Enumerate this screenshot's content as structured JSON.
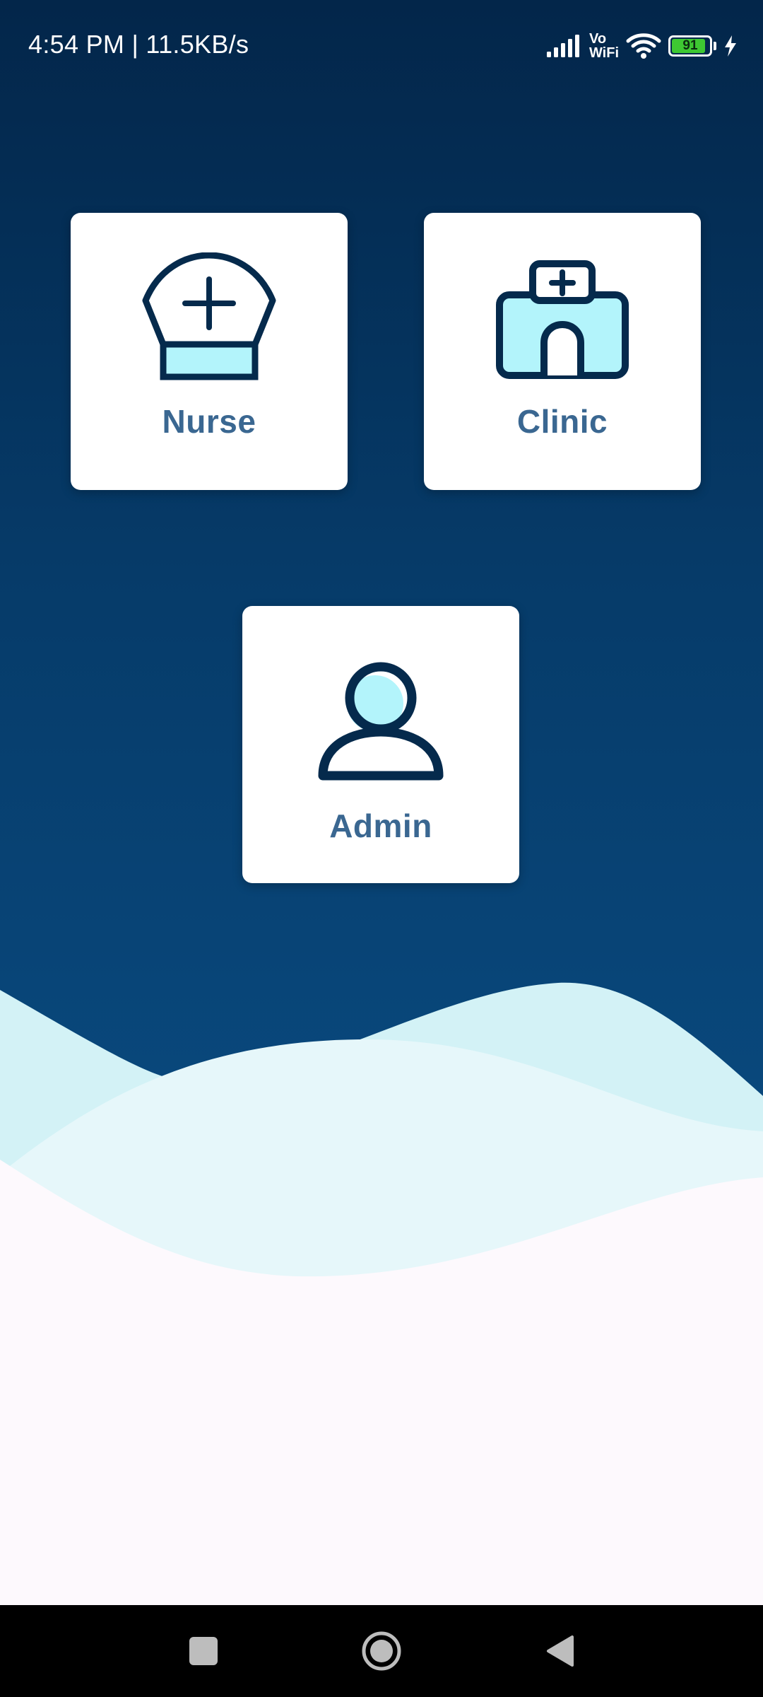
{
  "status_bar": {
    "time": "4:54 PM | 11.5KB/s",
    "vo_label": "Vo",
    "wifi_label": "WiFi",
    "battery_level": "91",
    "battery_fraction": 0.91,
    "icons": [
      "signal-icon",
      "vowifi-icon",
      "wifi-icon",
      "battery-icon",
      "charging-icon"
    ]
  },
  "roles": {
    "nurse": {
      "label": "Nurse",
      "icon": "nurse-cap-icon"
    },
    "clinic": {
      "label": "Clinic",
      "icon": "clinic-building-icon"
    },
    "admin": {
      "label": "Admin",
      "icon": "user-icon"
    }
  },
  "nav": {
    "icons": [
      "recents-square-icon",
      "home-circle-icon",
      "back-triangle-icon"
    ]
  },
  "colors": {
    "background_top": "#03264a",
    "background_bottom": "#0a4c82",
    "icon_stroke": "#052a4c",
    "icon_fill": "#b3f4fb",
    "label": "#3a6791",
    "wave_light": "#d6f4f8",
    "page_bottom": "#fdf9fd"
  }
}
